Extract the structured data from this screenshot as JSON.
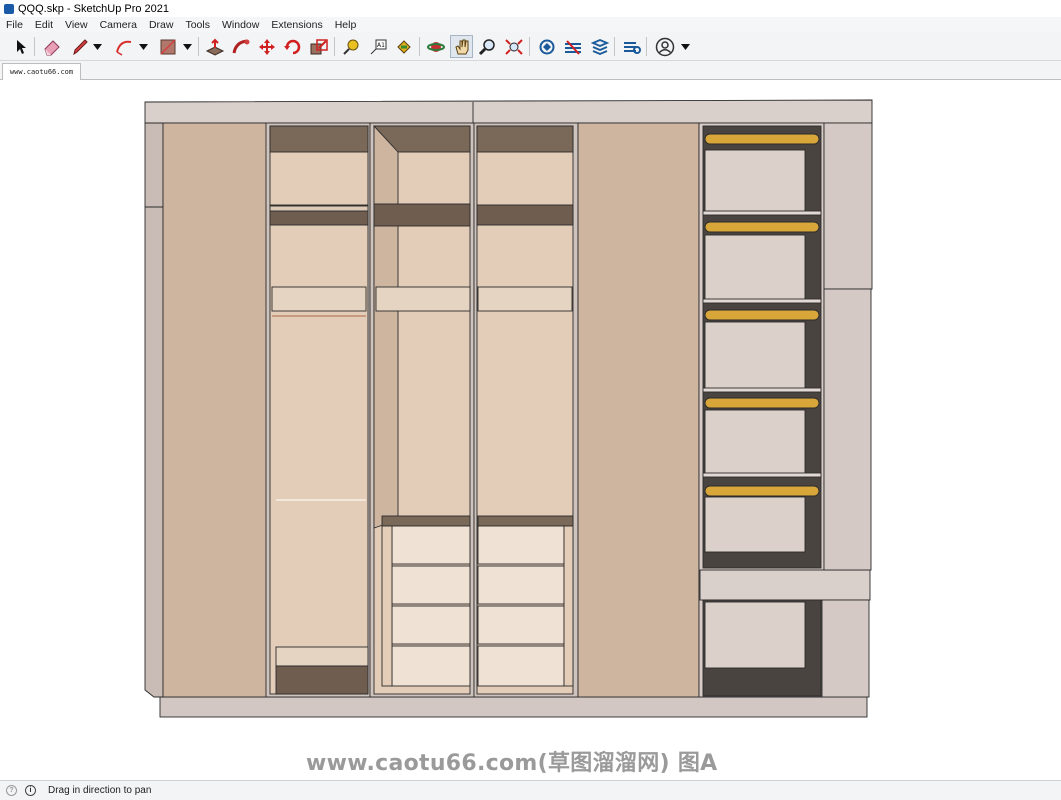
{
  "window": {
    "title": "QQQ.skp - SketchUp Pro 2021"
  },
  "menu": [
    "File",
    "Edit",
    "View",
    "Camera",
    "Draw",
    "Tools",
    "Window",
    "Extensions",
    "Help"
  ],
  "toolbar": {
    "tools": [
      "select-icon",
      "eraser-icon",
      "pencil-icon",
      "arc-icon",
      "rectangle-icon",
      "push-pull-icon",
      "follow-me-icon",
      "move-icon",
      "rotate-icon",
      "scale-icon",
      "tape-measure-icon",
      "text-icon",
      "paint-bucket-icon",
      "orbit-icon",
      "pan-icon",
      "zoom-icon",
      "zoom-extents-icon",
      "warehouse-icon",
      "extension-warehouse-icon",
      "layout-icon",
      "extension-manager-icon",
      "account-icon"
    ],
    "active_tool": "pan-icon"
  },
  "scene_tab": {
    "label": "www.caotu66.com"
  },
  "watermark": "www.caotu66.com(草图溜溜网) 图A",
  "status": {
    "message": "Drag in direction to pan"
  },
  "colors": {
    "panel": "#cdb5a0",
    "interior": "#e3cdb8",
    "frame": "#ccc0bb",
    "rod": "#d8a639",
    "shadow": "#6f5c4c"
  }
}
